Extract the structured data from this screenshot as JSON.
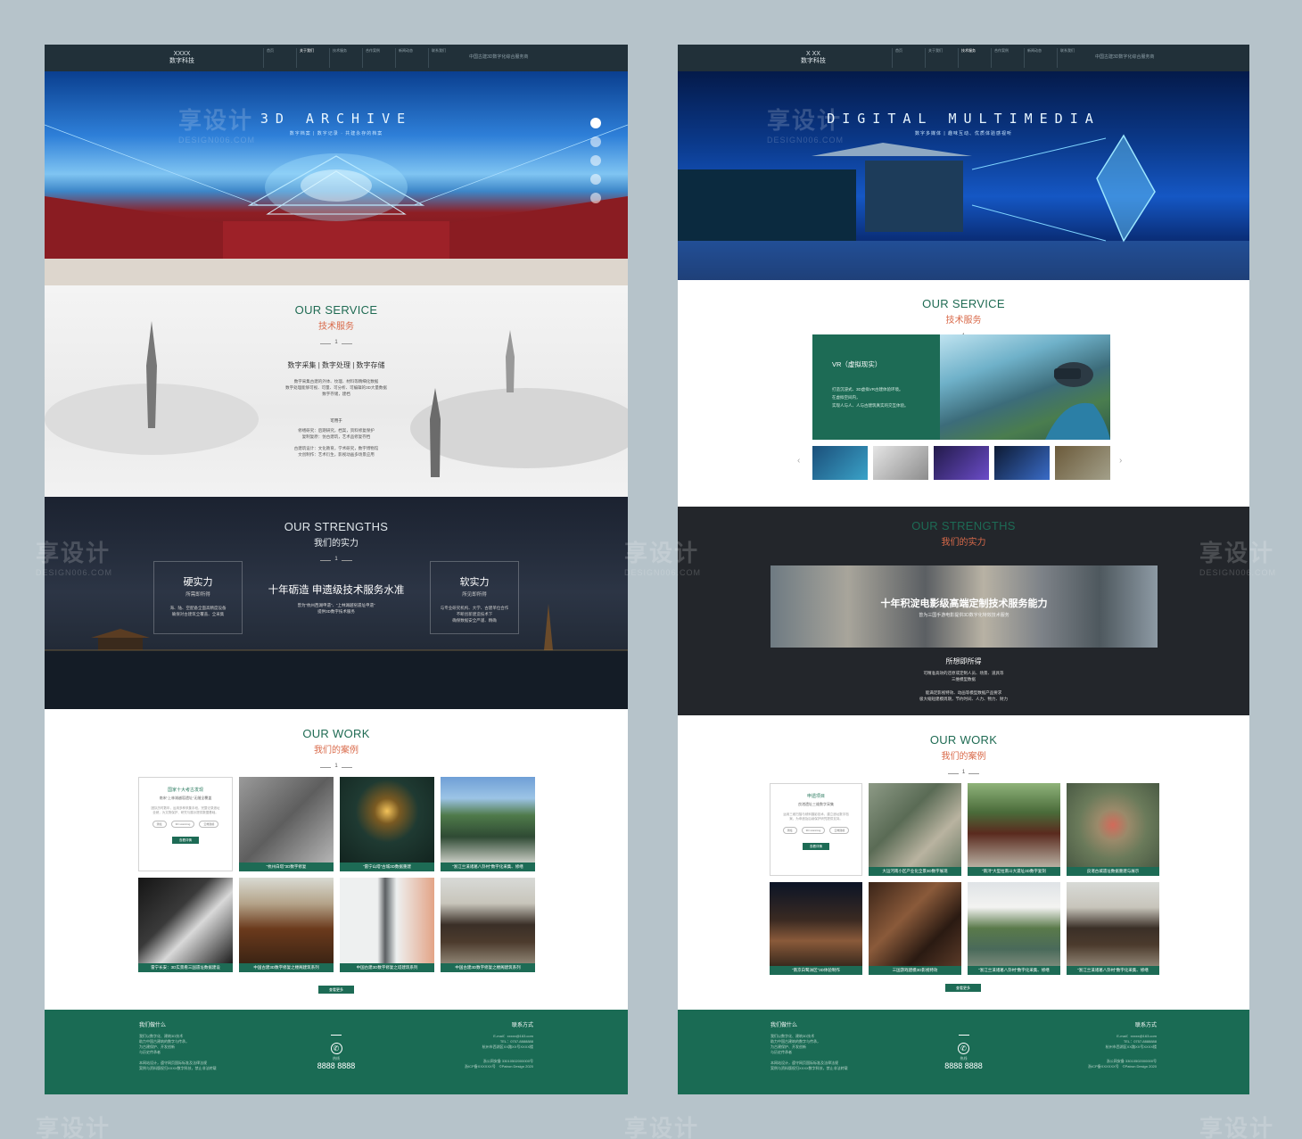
{
  "left": {
    "brand": [
      "XXXX",
      "数字科技"
    ],
    "nav": [
      "首页",
      "关于我们",
      "技术服务",
      "合作案例",
      "新闻动态",
      "联系我们"
    ],
    "tagline": "中国古建3D数字化综合服务商",
    "hero": {
      "title": "3D ARCHIVE",
      "subtitle": "数字档案 | 数字记录 · 共建永存的档案"
    },
    "service": {
      "en": "OUR SERVICE",
      "cn": "技术服务",
      "num": "1",
      "heading": "数字采集 | 数字处理 | 数字存储",
      "lines": [
        "数字采集古建的外体、纹理、材料等精细化数据",
        "数字处理能够可视、可量、可分析、可编辑的3D大量数据",
        "数字存储，建档"
      ],
      "poem_title": "可用于",
      "poem": [
        "修缮研究：后期研究，档案，资料修复保护",
        "复制复原：仿古建筑，艺术品修复存档",
        "古建筑设计：文化教育，学术研究，数字博物馆",
        "文创制作：艺术衍生，影视动画多场景应用"
      ]
    },
    "strengths": {
      "en": "OUR STRENGTHS",
      "cn": "我们的实力",
      "num": "1",
      "hard_title": "硬实力",
      "hard_sub": "所需即所得",
      "hard_text": [
        "海、陆、空配备全面高精度设备",
        "确保对古建筑全覆盖、全采集"
      ],
      "main": "十年砺造 申遗级技术服务水准",
      "main_sub": [
        "曾为“杭州西湖申遗”、“上林湖越窑遗址申遗”",
        "提供3D数字技术服务"
      ],
      "soft_title": "软实力",
      "soft_sub": "所见即所得",
      "soft_text": [
        "与专业研究机构、大学、古建单位合作",
        "不断创新建造技术下",
        "确保数据安全严谨、精确"
      ]
    },
    "work": {
      "en": "OUR WORK",
      "cn": "我们的案例",
      "num": "1",
      "intro": {
        "t1": "国家十大考古发现",
        "t2": "南宋“上林湖越窑遗址”无缝全覆盖",
        "t3": "团队历时数年，运用多种采集手段，完整记录遗址全貌，为文物保护、研究与展示提供数据基础。",
        "tags": [
          "测绘",
          "3D scanning",
          "云端建模"
        ],
        "btn": "查看详情"
      },
      "captions": [
        "“杭州白塔”3D数字修复",
        "“雷宁山塔”古城3D数据重建",
        "“浙江兰溪诸葛八卦村”数字化采集、修缮",
        "雷宁长安：3D实景看三国遗址数据建设",
        "中国古建3D数字修复之楼阁建筑系列",
        "中国古建3D数字修复之塔建筑系列",
        "中国古建3D数字修复之楼阁建筑系列"
      ],
      "more": "查看更多"
    },
    "footer": {
      "h1": "我们做什么",
      "p1": [
        "我们以数字化、建筑3D技术",
        "助力中国古建筑的数字与传承，",
        "为古建保护、开发创新",
        "与历史传承者"
      ],
      "p2": [
        "本网站设计，遵守网页国际标准及法律法规",
        "案例与资料版权归XXXX数字科技，禁止非法转载"
      ],
      "phone_label": "热线",
      "phone": "8888 8888",
      "h2": "联系方式",
      "p3": [
        "E-mail：xxxxx@163.com",
        "TEL：0757-8888888",
        "杭州市西湖区XX路XX号XXXX楼"
      ],
      "p4": [
        "浙公网安备 33010502000000号",
        "浙ICP备XXXXXX号　©Patron Design 2020"
      ]
    }
  },
  "right": {
    "brand": [
      "X XX",
      "数字科技"
    ],
    "nav": [
      "首页",
      "关于我们",
      "技术服务",
      "合作案例",
      "新闻动态",
      "联系我们"
    ],
    "tagline": "中国古建3D数字化综合服务商",
    "hero": {
      "title": "DIGITAL MULTIMEDIA",
      "subtitle": "数字多媒体 | 趣味互动、优质体验感视听"
    },
    "service": {
      "en": "OUR SERVICE",
      "cn": "技术服务",
      "num": "1",
      "vr_title": "VR（虚拟现实）",
      "vr_text": [
        "打造沉浸式、3D虚拟VR古建体验环境。",
        "在虚拟空间内，",
        "实现人与人、人与古建筑真实的交互体验。"
      ]
    },
    "strengths": {
      "en": "OUR STRENGTHS",
      "cn": "我们的实力",
      "main": "十年积淀电影级高端定制技术服务能力",
      "main_sub": "曾为三国手游电影提供3D数字化特效技术服务",
      "sub_title": "所想即所得",
      "sub_lines": [
        "可精准高效的还原或定制人员、场景、道具等",
        "三维模型数据"
      ],
      "sub_lines2": [
        "能满足影视特效、动画等模型数据产品要求",
        "极大缩短建模周期，节约时间、人力、物力、财力"
      ]
    },
    "work": {
      "en": "OUR WORK",
      "cn": "我们的案例",
      "num": "1",
      "intro": {
        "t1": "申遗项目",
        "t2": "良渚遗址三维数字采集",
        "t3": "运用三维扫描与倾斜摄影技术，建立遗址数字档案，为申遗及后续保护研究提供支持。",
        "tags": [
          "测绘",
          "3D scanning",
          "云端建模"
        ],
        "btn": "查看详情"
      },
      "captions": [
        "大运河南小区产业化全景3D数字展现",
        "“南浔”大型拉南斗大遗址3D数字复刻",
        "良渚古城遗址数据重建与展示",
        "“南京白鹭洲区”3D体验制作",
        "三国游戏建模3D影视特效",
        "“浙江兰溪诸葛八卦村”数字化采集、修缮",
        "“浙江兰溪诸葛八卦村”数字化采集、修缮"
      ],
      "more": "查看更多"
    },
    "footer": {
      "h1": "我们做什么",
      "p1": [
        "我们以数字化、建筑3D技术",
        "助力中国古建筑的数字与传承，",
        "为古建保护、开发创新",
        "与历史传承者"
      ],
      "p2": [
        "本网站设计，遵守网页国际标准及法律法规",
        "案例与资料版权归XXXX数字科技，禁止非法转载"
      ],
      "phone_label": "热线",
      "phone": "8888 8888",
      "h2": "联系方式",
      "p3": [
        "E-mail：xxxxx@163.com",
        "TEL：0757-8888888",
        "杭州市西湖区XX路XX号XXXX楼"
      ],
      "p4": [
        "浙公网安备 33010502000000号",
        "浙ICP备XXXXXX号　©Patron Design 2020"
      ]
    }
  },
  "watermark": {
    "text": "享设计",
    "sub": "DESIGN006.COM"
  }
}
